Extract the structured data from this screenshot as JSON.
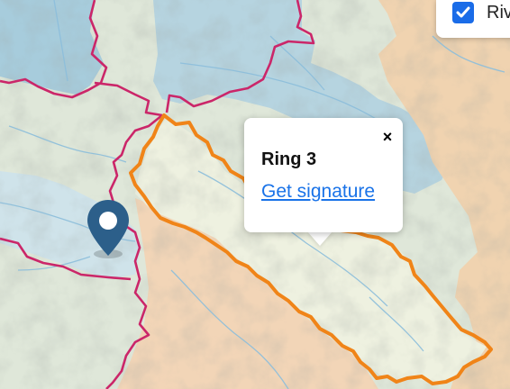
{
  "popup": {
    "title": "Ring 3",
    "link_label": "Get signature",
    "close_label": "×"
  },
  "layers": {
    "items": [
      {
        "label": "Riv",
        "checked": true
      }
    ]
  },
  "map": {
    "icons": [
      "map-marker-icon",
      "close-icon",
      "checkbox-icon"
    ],
    "colors": {
      "boundary_pink": "#cc1e6a",
      "ring_orange": "#f08418",
      "marker": "#2c5f8a",
      "basin_blue": "#8fc2d9",
      "plain_orange": "#f3cfa5",
      "terrain_green": "#cfe0c8",
      "river": "#7fb6d8"
    }
  }
}
